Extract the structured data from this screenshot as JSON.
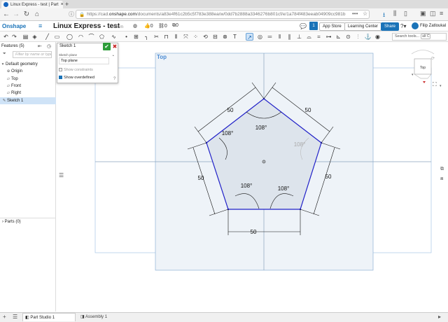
{
  "browser": {
    "tab_title": "Linux Express - test | Part",
    "url_prefix": "https://cad.",
    "url_domain": "onshape.com",
    "url_path": "/documents/a83e4f61c2b5c5f783e388ea/w/0dd7b2888a3346276b801cf/e/1a784f483eeab04909cc981b"
  },
  "app": {
    "logo": "Onshape",
    "doc_title": "Linux Express - test",
    "branch": "Main",
    "likes": "0",
    "links": "0",
    "versions": "0",
    "app_store_label": "App Store",
    "learning_center_label": "Learning Center",
    "share_label": "Share",
    "notification_count": "1",
    "user_name": "Filip Zatloukal"
  },
  "toolbar": {
    "search_placeholder": "Search tools...",
    "search_shortcut": "alt C"
  },
  "features": {
    "header": "Features (5)",
    "filter_placeholder": "Filter by name or type",
    "items": [
      {
        "label": "Default geometry",
        "icon": "caret-down-icon"
      },
      {
        "label": "Origin",
        "icon": "origin-icon"
      },
      {
        "label": "Top",
        "icon": "plane-icon"
      },
      {
        "label": "Front",
        "icon": "plane-icon"
      },
      {
        "label": "Right",
        "icon": "plane-icon"
      },
      {
        "label": "Sketch 1",
        "icon": "sketch-icon"
      }
    ],
    "parts_label": "Parts (0)"
  },
  "sketch_dialog": {
    "title": "Sketch 1",
    "plane_label": "Sketch plane",
    "plane_value": "Top plane",
    "show_constraints": "Show constraints",
    "show_overdefined": "Show overdefined",
    "show_constraints_checked": false,
    "show_overdefined_checked": true
  },
  "canvas": {
    "plane_label": "Top",
    "viewcube_face": "Top",
    "sketch_color": "#2020c8",
    "dimension_color": "#111111",
    "angle_dimensions": [
      "108°",
      "108°",
      "108°",
      "108°",
      "108°"
    ],
    "length_dimensions": [
      "50",
      "50",
      "50",
      "50",
      "50"
    ]
  },
  "bottom_tabs": [
    {
      "label": "Part Studio 1",
      "active": true
    },
    {
      "label": "Assembly 1",
      "active": false
    }
  ]
}
